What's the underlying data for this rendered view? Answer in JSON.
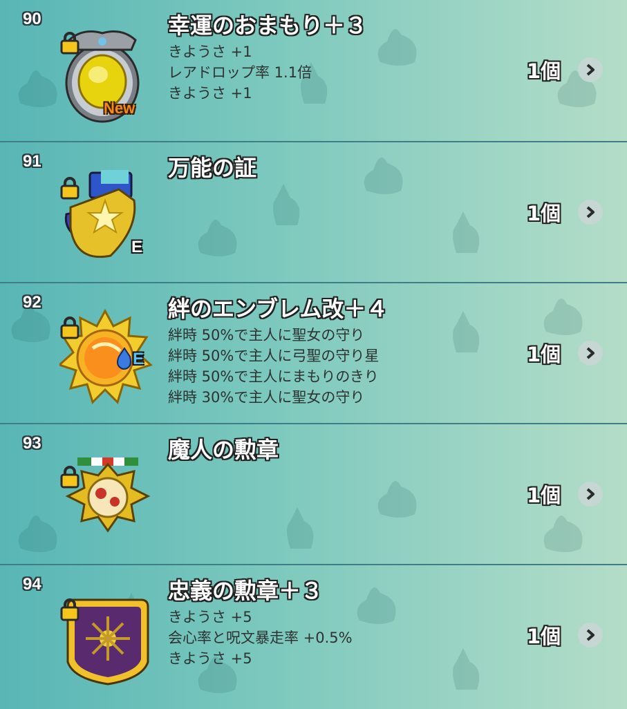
{
  "items": [
    {
      "number": "90",
      "name": "幸運のおまもり＋３",
      "effects": [
        "きようさ +1",
        "レアドロップ率 1.1倍",
        "きようさ +1"
      ],
      "quantity": "1個",
      "badge": "New",
      "icon": "lucky-charm-icon"
    },
    {
      "number": "91",
      "name": "万能の証",
      "effects": [],
      "quantity": "1個",
      "badge": "E",
      "icon": "gold-shield-emblem-icon"
    },
    {
      "number": "92",
      "name": "絆のエンブレム改＋４",
      "effects": [
        "絆時 50%で主人に聖女の守り",
        "絆時 50%で主人に弓聖の守り星",
        "絆時 50%で主人にまもりのきり",
        "絆時 30%で主人に聖女の守り"
      ],
      "quantity": "1個",
      "badge": "E",
      "icon": "bond-emblem-sun-icon"
    },
    {
      "number": "93",
      "name": "魔人の勲章",
      "effects": [],
      "quantity": "1個",
      "badge": "",
      "icon": "demon-medal-icon"
    },
    {
      "number": "94",
      "name": "忠義の勲章＋３",
      "effects": [
        "きようさ +5",
        "会心率と呪文暴走率 +0.5%",
        "きようさ +5"
      ],
      "quantity": "1個",
      "badge": "",
      "icon": "loyalty-medal-shield-icon"
    }
  ],
  "colors": {
    "bg_left": "#58b6b5",
    "bg_right": "#b4ddc8",
    "divider": "#3f7e86",
    "lock": "#f4c61d",
    "new_badge": "#f28a1e"
  }
}
